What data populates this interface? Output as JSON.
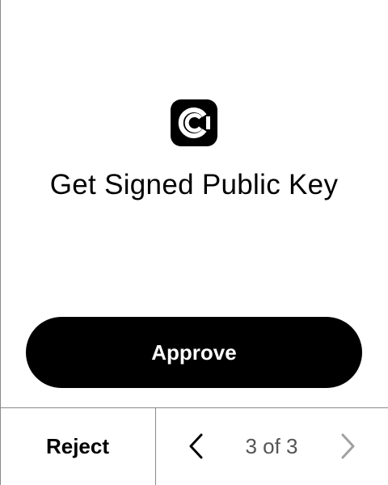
{
  "app": {
    "logo_icon": "ledger-style-app-logo-icon"
  },
  "screen": {
    "title": "Get Signed Public Key"
  },
  "actions": {
    "approve_label": "Approve",
    "reject_label": "Reject"
  },
  "pagination": {
    "indicator": "3 of 3",
    "current_page": 3,
    "total_pages": 3,
    "prev_icon": "chevron-left-icon",
    "next_icon": "chevron-right-icon",
    "next_disabled": true
  },
  "colors": {
    "background": "#ffffff",
    "primary": "#000000",
    "on_primary": "#ffffff",
    "divider": "#8a8a8a",
    "muted_text": "#555555",
    "disabled_icon": "#a0a0a0"
  }
}
